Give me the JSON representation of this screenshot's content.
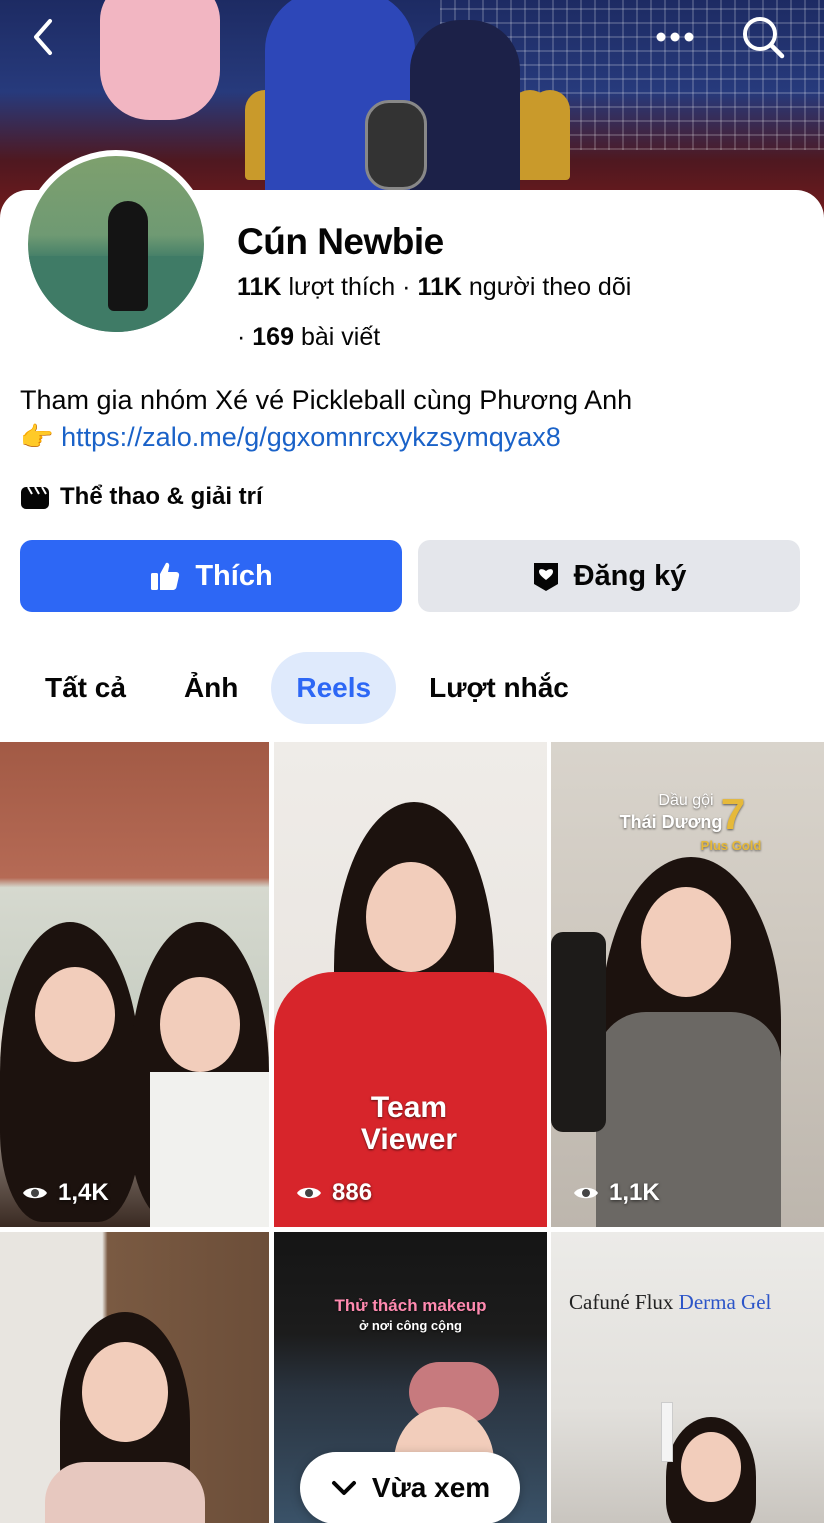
{
  "header": {
    "back_icon": "chevron-left-icon",
    "more_icon": "more-horizontal-icon",
    "search_icon": "search-icon"
  },
  "profile": {
    "name": "Cún Newbie",
    "likes_count": "11K",
    "likes_label": "lượt thích",
    "separator": "·",
    "followers_count": "11K",
    "followers_label": "người theo dõi",
    "posts_count": "169",
    "posts_label": "bài viết",
    "bio_text": "Tham gia nhóm Xé vé Pickleball cùng Phương Anh",
    "bio_emoji": "👉",
    "bio_link": "https://zalo.me/g/ggxomnrcxykzsymqyax8",
    "category": "Thể thao & giải trí"
  },
  "actions": {
    "like_label": "Thích",
    "subscribe_label": "Đăng ký"
  },
  "tabs": [
    {
      "label": "Tất cả",
      "active": false
    },
    {
      "label": "Ảnh",
      "active": false
    },
    {
      "label": "Reels",
      "active": true
    },
    {
      "label": "Lượt nhắc",
      "active": false
    }
  ],
  "reels": [
    {
      "views": "1,4K"
    },
    {
      "views": "886",
      "overlay_text": "Team Viewer"
    },
    {
      "views": "1,1K",
      "overlay_title": "Dầu gội",
      "overlay_brand": "Thái Dương",
      "overlay_number": "7",
      "overlay_sub": "Plus Gold"
    },
    {
      "views": ""
    },
    {
      "views": "",
      "overlay_title": "Thử thách makeup",
      "overlay_sub": "ở nơi công cộng"
    },
    {
      "views": "",
      "overlay_brand": "Cafuné Flux",
      "overlay_sub": "Derma Gel"
    }
  ],
  "floating": {
    "recent_label": "Vừa xem",
    "icon": "chevron-down-icon"
  },
  "colors": {
    "primary": "#2d67f5",
    "link": "#1a62c8",
    "secondary_bg": "#e4e6eb",
    "active_tab_bg": "#dfeafc"
  }
}
